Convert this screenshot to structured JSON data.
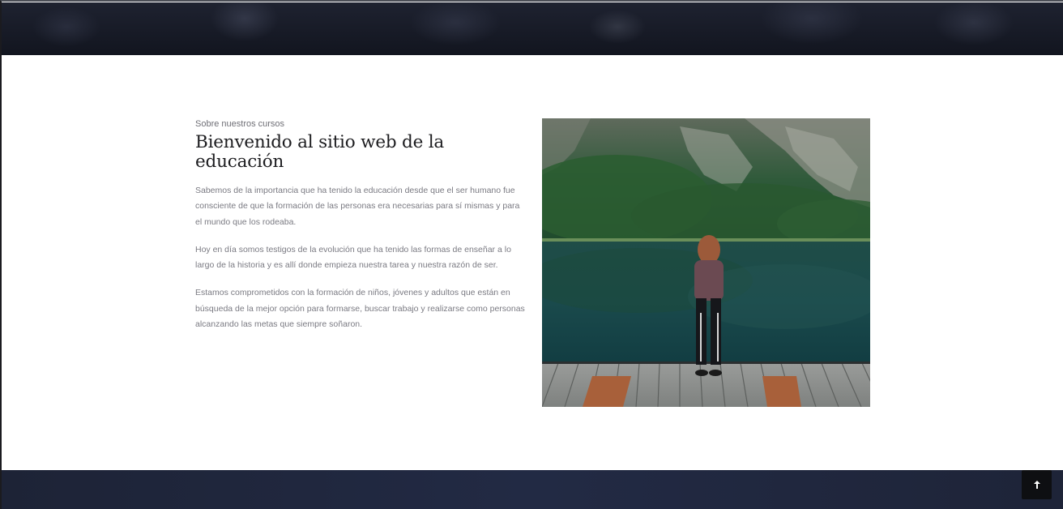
{
  "about": {
    "eyebrow": "Sobre nuestros cursos",
    "heading": "Bienvenido al sitio web de la educación",
    "paragraphs": [
      "Sabemos de la importancia que ha tenido la educación desde que el ser humano fue consciente de que la formación de las personas era necesarias para sí mismas y para el mundo que los rodeaba.",
      "Hoy en día somos testigos de la evolución que ha tenido las formas de enseñar a lo largo de la historia y es allí donde empieza nuestra tarea y nuestra razón de ser.",
      "Estamos comprometidos con la formación de niños, jóvenes y adultos que están en búsqueda de la mejor opción para formarse, buscar trabajo y realizarse como personas alcanzando las metas que siempre soñaron."
    ]
  },
  "icons": {
    "back_to_top": "arrow-up-icon"
  },
  "colors": {
    "hero_overlay": "#12151f",
    "footer_bg": "#222a44",
    "heading": "#1c1c1f",
    "body_text": "#7a7a82",
    "back_to_top_bg": "#0e0f12"
  }
}
